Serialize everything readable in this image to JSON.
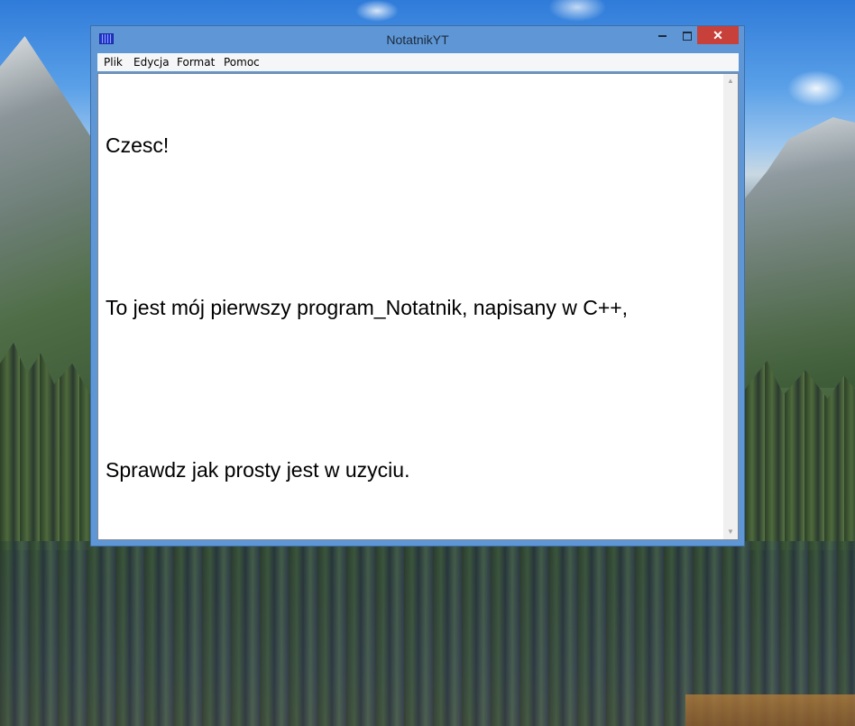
{
  "window": {
    "title": "NotatnikYT",
    "close_glyph": "✕"
  },
  "menu": {
    "items": [
      "Plik",
      "Edycja",
      "Format",
      "Pomoc"
    ]
  },
  "editor": {
    "lines": [
      "Czesc!",
      "",
      "To jest mój pierwszy program_Notatnik, napisany w C++,",
      "",
      "Sprawdz jak prosty jest w uzyciu."
    ]
  },
  "scrollbar": {
    "up_glyph": "▲",
    "down_glyph": "▼"
  },
  "colors": {
    "titlebar": "#5f97d6",
    "close_button": "#c7403a",
    "menubar": "#f5f6f7",
    "editor_bg": "#ffffff"
  }
}
